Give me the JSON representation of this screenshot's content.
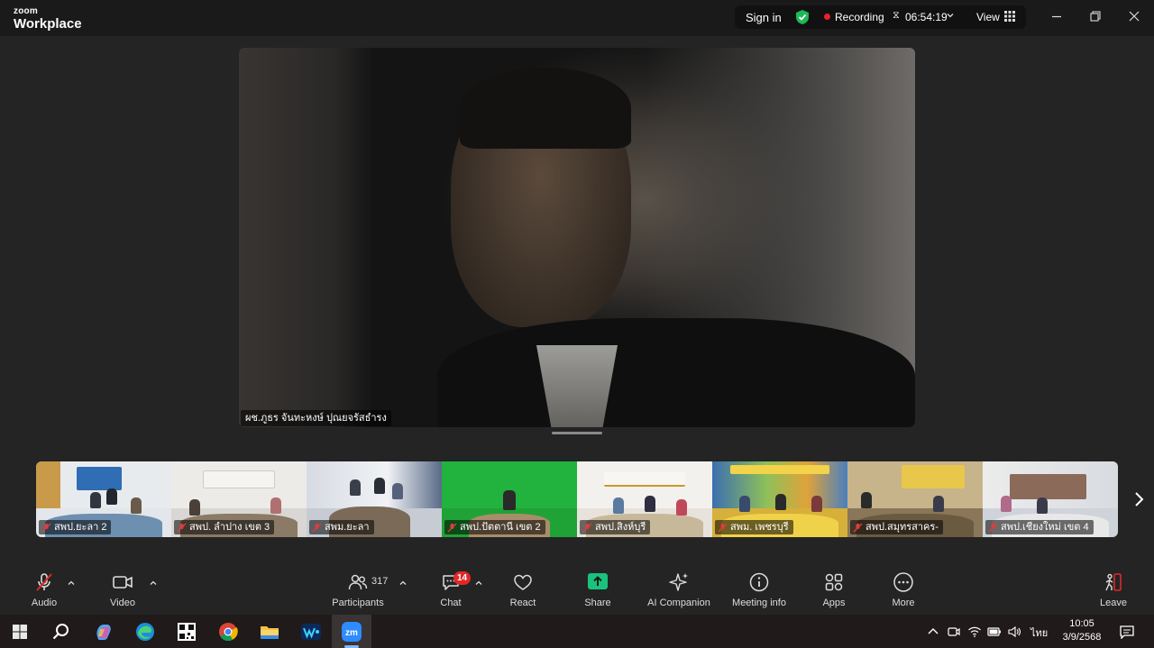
{
  "titlebar": {
    "logo_line1": "zoom",
    "logo_line2": "Workplace",
    "sign_in": "Sign in",
    "recording": "Recording",
    "timer": "06:54:19",
    "view": "View"
  },
  "main_video": {
    "name": "ผช.ภูธร จันทะหงษ์ ปุณยจรัสธำรง"
  },
  "gallery": [
    {
      "name": "สพป.ยะลา 2"
    },
    {
      "name": "สพป. ลำปาง เขต 3"
    },
    {
      "name": "สพม.ยะลา"
    },
    {
      "name": "สพป.ปัตตานี เขต 2"
    },
    {
      "name": "สพป.สิงห์บุรี"
    },
    {
      "name": "สพม. เพชรบุรี"
    },
    {
      "name": "สพป.สมุทรสาคร-"
    },
    {
      "name": "สพป.เชียงใหม่ เขต 4"
    }
  ],
  "toolbar": {
    "audio": "Audio",
    "video": "Video",
    "participants": "Participants",
    "participants_count": "317",
    "chat": "Chat",
    "chat_badge": "14",
    "react": "React",
    "share": "Share",
    "ai_companion": "AI Companion",
    "meeting_info": "Meeting info",
    "apps": "Apps",
    "more": "More",
    "leave": "Leave"
  },
  "taskbar": {
    "language": "ไทย",
    "time": "10:05",
    "date": "3/9/2568"
  },
  "colors": {
    "accent_green": "#1db954",
    "share_green": "#19c37d",
    "recording_red": "#e8212f",
    "leave_red": "#e02828"
  }
}
